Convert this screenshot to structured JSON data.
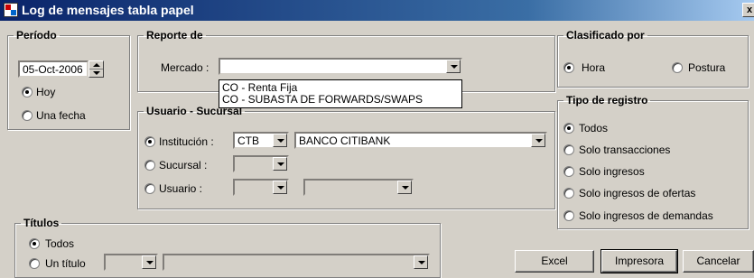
{
  "window": {
    "title": "Log de mensajes tabla papel",
    "close": "x"
  },
  "periodo": {
    "legend": "Período",
    "date_value": "05-Oct-2006",
    "hoy_label": "Hoy",
    "una_fecha_label": "Una fecha",
    "selected": "Hoy"
  },
  "reporte": {
    "legend": "Reporte de",
    "mercado_label": "Mercado :",
    "mercado_value": "",
    "options": [
      "CO - Renta Fija",
      "CO - SUBASTA DE FORWARDS/SWAPS"
    ]
  },
  "usuario": {
    "legend": "Usuario - Sucursal",
    "institucion_label": "Institución :",
    "institucion_code": "CTB",
    "institucion_name": "BANCO CITIBANK",
    "sucursal_label": "Sucursal :",
    "usuario_label": "Usuario :",
    "selected": "Institución"
  },
  "clasificado": {
    "legend": "Clasificado por",
    "hora_label": "Hora",
    "postura_label": "Postura",
    "selected": "Hora"
  },
  "tipo": {
    "legend": "Tipo de registro",
    "options": [
      "Todos",
      "Solo transacciones",
      "Solo ingresos",
      "Solo ingresos de ofertas",
      "Solo ingresos de demandas"
    ],
    "selected": "Todos"
  },
  "titulos": {
    "legend": "Títulos",
    "todos_label": "Todos",
    "un_titulo_label": "Un título",
    "selected": "Todos"
  },
  "buttons": {
    "excel": "Excel",
    "impresora": "Impresora",
    "cancelar": "Cancelar"
  }
}
